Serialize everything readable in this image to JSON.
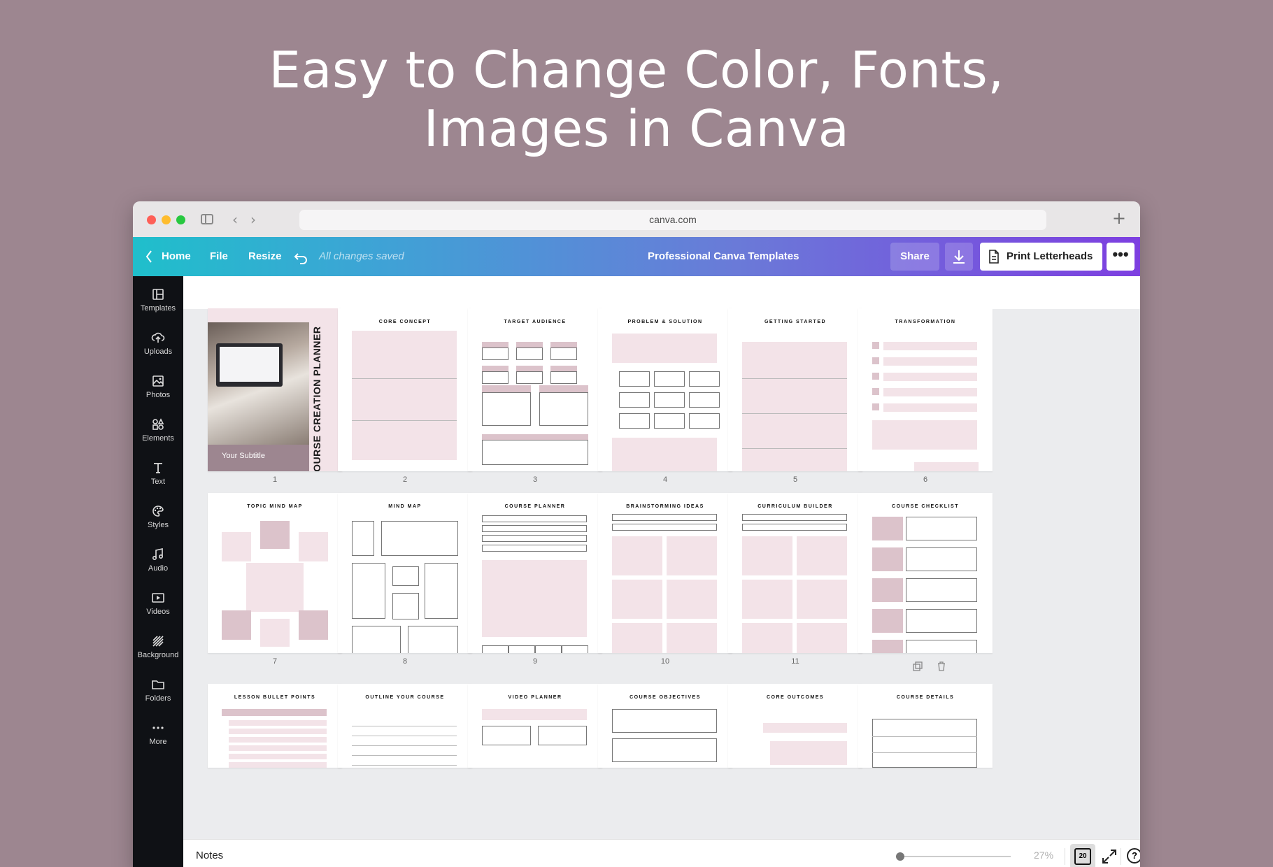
{
  "headline": {
    "line1": "Easy to Change Color, Fonts,",
    "line2": "Images in Canva"
  },
  "browser": {
    "url": "canva.com",
    "back": "‹",
    "forward": "›",
    "new_tab": "+"
  },
  "toolbar": {
    "home": "Home",
    "file": "File",
    "resize": "Resize",
    "saved": "All changes saved",
    "doc_title": "Professional Canva Templates",
    "share": "Share",
    "print": "Print Letterheads",
    "more": "•••"
  },
  "sidebar": {
    "items": [
      "Templates",
      "Uploads",
      "Photos",
      "Elements",
      "Text",
      "Styles",
      "Audio",
      "Videos",
      "Background",
      "Folders",
      "More"
    ]
  },
  "pages": {
    "cover_title": "COURSE CREATION PLANNER",
    "cover_subtitle": "Your Subtitle",
    "titles": [
      "",
      "CORE CONCEPT",
      "TARGET AUDIENCE",
      "PROBLEM & SOLUTION",
      "GETTING STARTED",
      "TRANSFORMATION",
      "TOPIC MIND MAP",
      "MIND MAP",
      "COURSE PLANNER",
      "BRAINSTORMING IDEAS",
      "CURRICULUM BUILDER",
      "COURSE CHECKLIST",
      "LESSON BULLET POINTS",
      "OUTLINE YOUR COURSE",
      "VIDEO PLANNER",
      "COURSE OBJECTIVES",
      "CORE OUTCOMES",
      "COURSE DETAILS"
    ],
    "numbers": [
      "1",
      "2",
      "3",
      "4",
      "5",
      "6",
      "7",
      "8",
      "9",
      "10",
      "11",
      ""
    ]
  },
  "statusbar": {
    "notes": "Notes",
    "zoom": "27%",
    "page_count": "20",
    "help": "?"
  },
  "colors": {
    "background": "#9d8690",
    "accent_pink": "#f3e3e8",
    "accent_mauve": "#9d8690"
  }
}
